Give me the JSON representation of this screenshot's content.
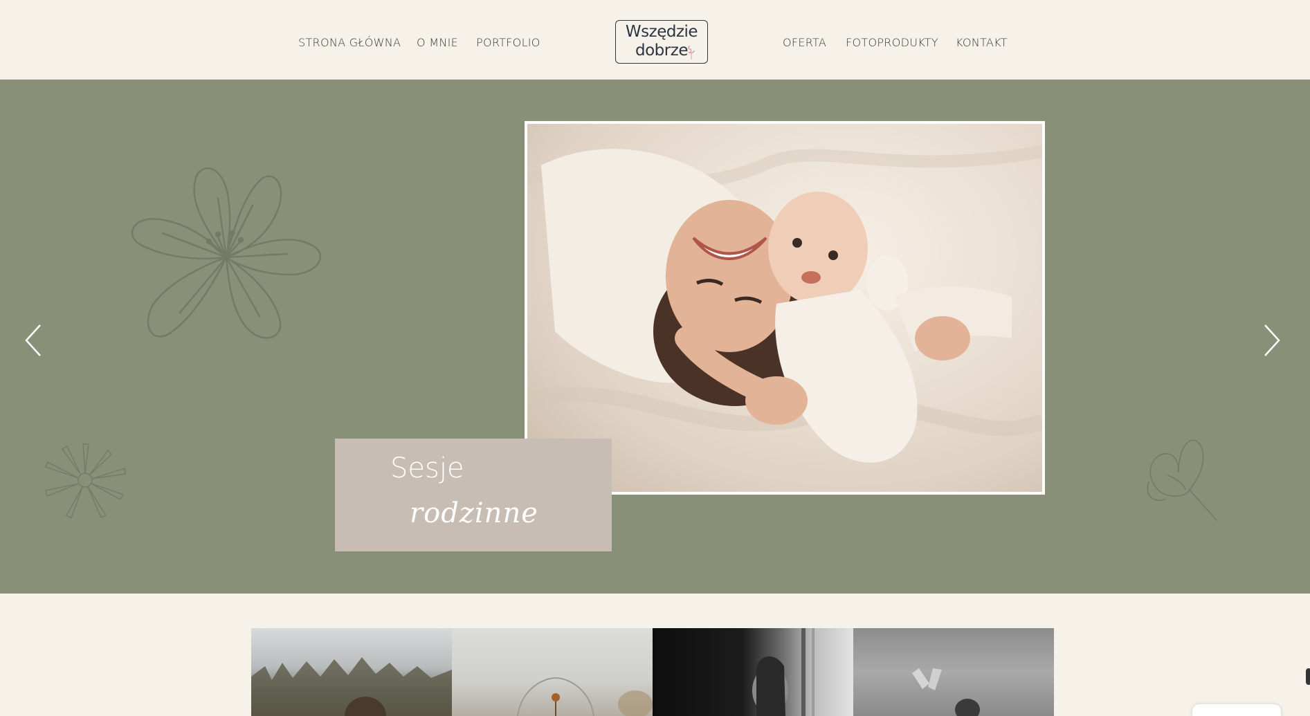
{
  "nav": {
    "left": [
      {
        "label": "STRONA GŁÓWNA"
      },
      {
        "label": "O MNIE"
      },
      {
        "label": "PORTFOLIO"
      }
    ],
    "right": [
      {
        "label": "OFERTA"
      },
      {
        "label": "FOTOPRODUKTY"
      },
      {
        "label": "KONTAKT"
      }
    ]
  },
  "logo": {
    "line1": "Wszędzie",
    "line2": "dobrze"
  },
  "hero": {
    "caption_title": "Sesje",
    "caption_script": "rodzinne",
    "background_color": "#889178",
    "caption_box_color": "#c7bdb4",
    "prev_icon": "chevron-left-icon",
    "next_icon": "chevron-right-icon"
  },
  "colors": {
    "page_background": "#f6f2ea",
    "text": "#34393a",
    "flower_line": "#737b64"
  }
}
